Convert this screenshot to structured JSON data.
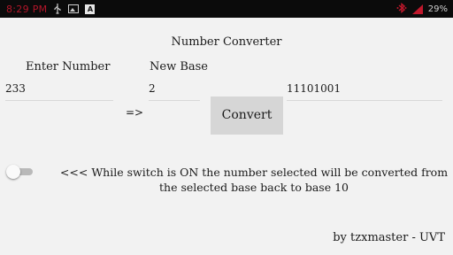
{
  "status_bar": {
    "time": "8:29 PM",
    "battery": "29%",
    "left_icons": [
      "usb-icon",
      "image-icon",
      "a-app-icon"
    ],
    "right_icons": [
      "bluetooth-icon",
      "signal-icon"
    ]
  },
  "app": {
    "title": "Number Converter",
    "enter_number_label": "Enter Number",
    "new_base_label": "New Base",
    "number_value": "233",
    "base_value": "2",
    "arrow": "=>",
    "result_value": "11101001",
    "convert_label": "Convert",
    "switch_on": false,
    "switch_info": "<<< While switch is ON the number selected will be converted from the selected base back to base 10",
    "credit": "by tzxmaster - UVT"
  },
  "colors": {
    "status_bar_bg": "#0b0b0b",
    "accent_red": "#b3162a",
    "background": "#f2f2f2",
    "button_bg": "#d6d6d6"
  }
}
